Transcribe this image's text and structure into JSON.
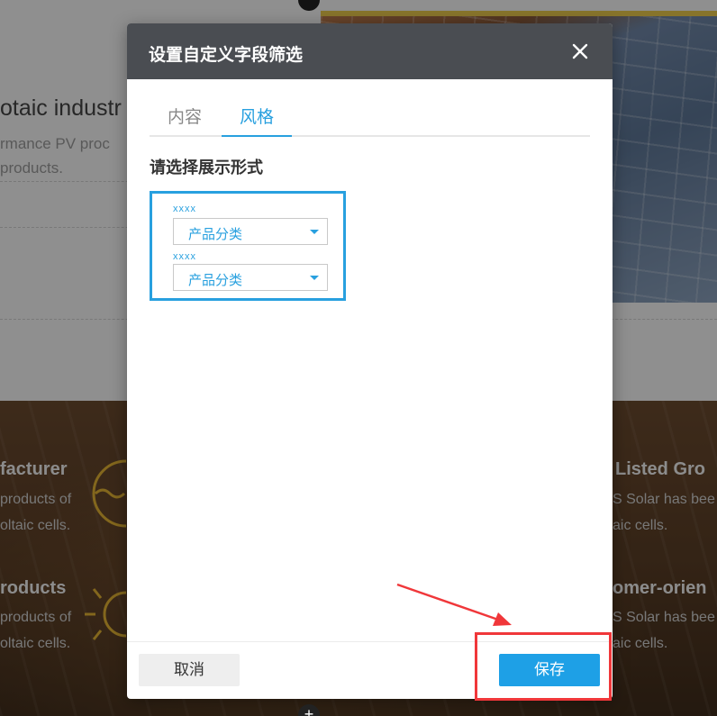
{
  "background": {
    "top_title": "otaic industr",
    "top_line1": "rmance PV proc",
    "top_line2": "products.",
    "left_block1_head": "facturer",
    "left_block1_line1": "products of",
    "left_block1_line2": "oltaic cells.",
    "left_block2_head": "roducts",
    "left_block2_line1": "products of",
    "left_block2_line2": "oltaic cells.",
    "right_block1_head": "Listed Gro",
    "right_block1_line1": "S Solar has bee",
    "right_block1_line2": "aic cells.",
    "right_block2_head": "omer-orien",
    "right_block2_line1": "S Solar has bee",
    "right_block2_line2": "aic cells."
  },
  "modal": {
    "title": "设置自定义字段筛选",
    "close_icon": "close-icon",
    "tabs": [
      {
        "label": "内容",
        "active": false
      },
      {
        "label": "风格",
        "active": true
      }
    ],
    "section_label": "请选择展示形式",
    "preview": {
      "fields": [
        {
          "label": "xxxx",
          "value": "产品分类"
        },
        {
          "label": "xxxx",
          "value": "产品分类"
        }
      ]
    },
    "footer": {
      "cancel_label": "取消",
      "save_label": "保存"
    }
  },
  "colors": {
    "accent": "#28a0df",
    "save_button": "#1ea0e6",
    "header_bg": "#4a4d52",
    "annotation_red": "#f0373a"
  }
}
